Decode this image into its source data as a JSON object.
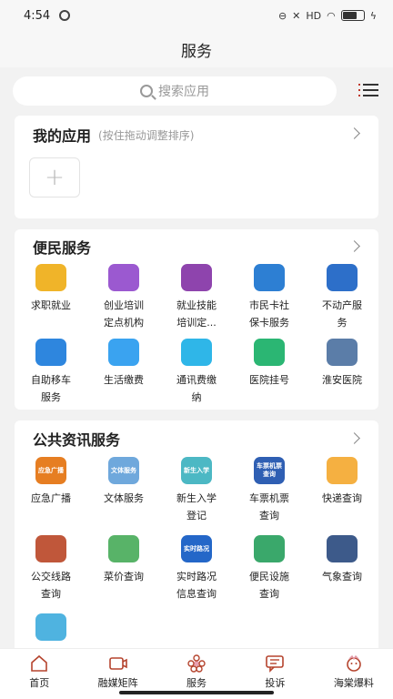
{
  "status": {
    "time": "4:54",
    "net": "HD"
  },
  "nav": {
    "title": "服务"
  },
  "search": {
    "placeholder": "搜索应用"
  },
  "my_apps": {
    "title": "我的应用",
    "hint": "(按住拖动调整排序)",
    "add": "+"
  },
  "convenience": {
    "title": "便民服务",
    "items": [
      {
        "label": "求职就业",
        "icon": "job-icon",
        "color": "#f0b429"
      },
      {
        "label": "创业培训定点机构",
        "icon": "training-icon",
        "color": "#9b59d0"
      },
      {
        "label": "就业技能培训定...",
        "icon": "skill-icon",
        "color": "#8e44ad"
      },
      {
        "label": "市民卡社保卡服务",
        "icon": "citizen-card-icon",
        "color": "#2d7fd3"
      },
      {
        "label": "不动产服务",
        "icon": "property-icon",
        "color": "#2d6fc9"
      },
      {
        "label": "自助移车服务",
        "icon": "car-move-icon",
        "color": "#2e86de"
      },
      {
        "label": "生活缴费",
        "icon": "water-drop-icon",
        "color": "#3aa3f0"
      },
      {
        "label": "通讯费缴纳",
        "icon": "phone-bill-icon",
        "color": "#2fb6e8"
      },
      {
        "label": "医院挂号",
        "icon": "hospital-registration-icon",
        "color": "#2bb673"
      },
      {
        "label": "淮安医院",
        "icon": "hospital-building-icon",
        "color": "#5b7da8"
      }
    ]
  },
  "public_info": {
    "title": "公共资讯服务",
    "items": [
      {
        "label": "应急广播",
        "icon": "emergency-broadcast-icon",
        "color": "#e67e22",
        "badge": "应急广播"
      },
      {
        "label": "文体服务",
        "icon": "culture-sports-icon",
        "color": "#6fa8dc",
        "badge": "文体服务"
      },
      {
        "label": "新生入学登记",
        "icon": "enrollment-icon",
        "color": "#4cb8c4",
        "badge": "新生入学"
      },
      {
        "label": "车票机票查询",
        "icon": "ticket-icon",
        "color": "#2f5fb3",
        "badge": "车票机票查询"
      },
      {
        "label": "快递查询",
        "icon": "express-icon",
        "color": "#f5b041"
      },
      {
        "label": "公交线路查询",
        "icon": "bus-icon",
        "color": "#c0573a"
      },
      {
        "label": "菜价查询",
        "icon": "vegetable-icon",
        "color": "#58b368"
      },
      {
        "label": "实时路况信息查询",
        "icon": "traffic-icon",
        "color": "#2467c8",
        "badge": "实时路况"
      },
      {
        "label": "便民设施查询",
        "icon": "facility-icon",
        "color": "#3aa86b"
      },
      {
        "label": "气象查询",
        "icon": "weather-icon",
        "color": "#3d5a8a"
      },
      {
        "label": "",
        "icon": "briefcase-icon",
        "color": "#4fb3e0"
      }
    ]
  },
  "tabs": [
    {
      "label": "首页",
      "icon": "home-icon"
    },
    {
      "label": "融媒矩阵",
      "icon": "video-icon"
    },
    {
      "label": "服务",
      "icon": "flower-icon"
    },
    {
      "label": "投诉",
      "icon": "complaint-icon"
    },
    {
      "label": "海棠爆料",
      "icon": "mascot-icon"
    }
  ]
}
